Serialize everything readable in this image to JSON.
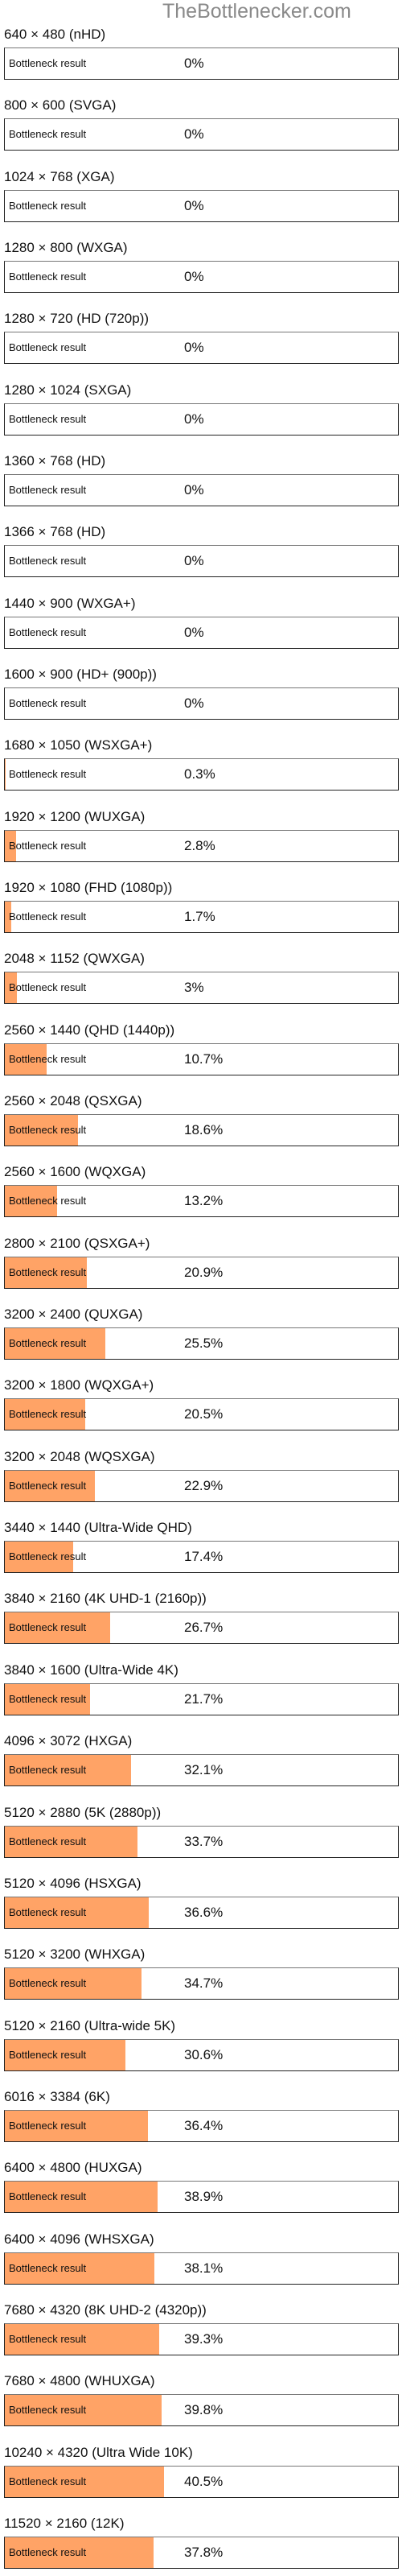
{
  "site": {
    "watermark": "TheBottlenecker.com"
  },
  "colors": {
    "fill": "#ffa366",
    "border": "#222222"
  },
  "chart_data": {
    "type": "bar",
    "orientation": "horizontal",
    "title": "",
    "bar_caption": "Bottleneck result",
    "xlim": [
      0,
      100
    ],
    "unit": "%",
    "categories": [
      "640 × 480 (nHD)",
      "800 × 600 (SVGA)",
      "1024 × 768 (XGA)",
      "1280 × 800 (WXGA)",
      "1280 × 720 (HD (720p))",
      "1280 × 1024 (SXGA)",
      "1360 × 768 (HD)",
      "1366 × 768 (HD)",
      "1440 × 900 (WXGA+)",
      "1600 × 900 (HD+ (900p))",
      "1680 × 1050 (WSXGA+)",
      "1920 × 1200 (WUXGA)",
      "1920 × 1080 (FHD (1080p))",
      "2048 × 1152 (QWXGA)",
      "2560 × 1440 (QHD (1440p))",
      "2560 × 2048 (QSXGA)",
      "2560 × 1600 (WQXGA)",
      "2800 × 2100 (QSXGA+)",
      "3200 × 2400 (QUXGA)",
      "3200 × 1800 (WQXGA+)",
      "3200 × 2048 (WQSXGA)",
      "3440 × 1440 (Ultra-Wide QHD)",
      "3840 × 2160 (4K UHD-1 (2160p))",
      "3840 × 1600 (Ultra-Wide 4K)",
      "4096 × 3072 (HXGA)",
      "5120 × 2880 (5K (2880p))",
      "5120 × 4096 (HSXGA)",
      "5120 × 3200 (WHXGA)",
      "5120 × 2160 (Ultra-wide 5K)",
      "6016 × 3384 (6K)",
      "6400 × 4800 (HUXGA)",
      "6400 × 4096 (WHSXGA)",
      "7680 × 4320 (8K UHD-2 (4320p))",
      "7680 × 4800 (WHUXGA)",
      "10240 × 4320 (Ultra Wide 10K)",
      "11520 × 2160 (12K)"
    ],
    "values": [
      0,
      0,
      0,
      0,
      0,
      0,
      0,
      0,
      0,
      0,
      0.3,
      2.8,
      1.7,
      3,
      10.7,
      18.6,
      13.2,
      20.9,
      25.5,
      20.5,
      22.9,
      17.4,
      26.7,
      21.7,
      32.1,
      33.7,
      36.6,
      34.7,
      30.6,
      36.4,
      38.9,
      38.1,
      39.3,
      39.8,
      40.5,
      37.8
    ],
    "value_labels": [
      "0%",
      "0%",
      "0%",
      "0%",
      "0%",
      "0%",
      "0%",
      "0%",
      "0%",
      "0%",
      "0.3%",
      "2.8%",
      "1.7%",
      "3%",
      "10.7%",
      "18.6%",
      "13.2%",
      "20.9%",
      "25.5%",
      "20.5%",
      "22.9%",
      "17.4%",
      "26.7%",
      "21.7%",
      "32.1%",
      "33.7%",
      "36.6%",
      "34.7%",
      "30.6%",
      "36.4%",
      "38.9%",
      "38.1%",
      "39.3%",
      "39.8%",
      "40.5%",
      "37.8%"
    ]
  }
}
